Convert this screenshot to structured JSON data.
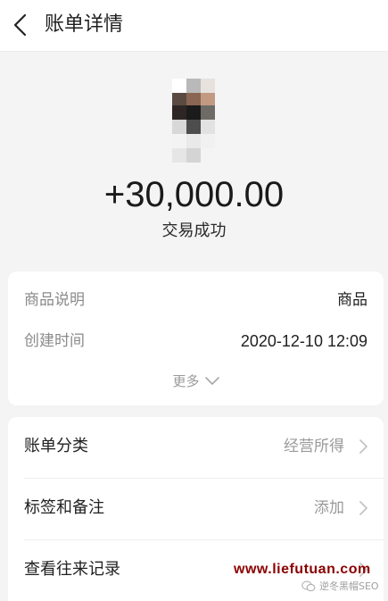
{
  "header": {
    "title": "账单详情",
    "back_icon": "chevron-left-icon"
  },
  "summary": {
    "amount": "+30,000.00",
    "status": "交易成功",
    "avatar": "pixelated-avatar"
  },
  "details": {
    "rows": [
      {
        "label": "商品说明",
        "value": "商品"
      },
      {
        "label": "创建时间",
        "value": "2020-12-10 12:09"
      }
    ],
    "more_label": "更多",
    "more_icon": "chevron-down-icon"
  },
  "actions": {
    "rows": [
      {
        "label": "账单分类",
        "value": "经营所得"
      },
      {
        "label": "标签和备注",
        "value": "添加"
      },
      {
        "label": "查看往来记录",
        "value": ""
      }
    ],
    "chevron_icon": "chevron-right-icon"
  },
  "watermark": {
    "url": "www.liefutuan.com",
    "account": "逆冬黑帽SEO"
  },
  "colors": {
    "background": "#f4f4f4",
    "card": "#ffffff",
    "watermark": "#8b0000",
    "muted": "#9a9a9a"
  }
}
